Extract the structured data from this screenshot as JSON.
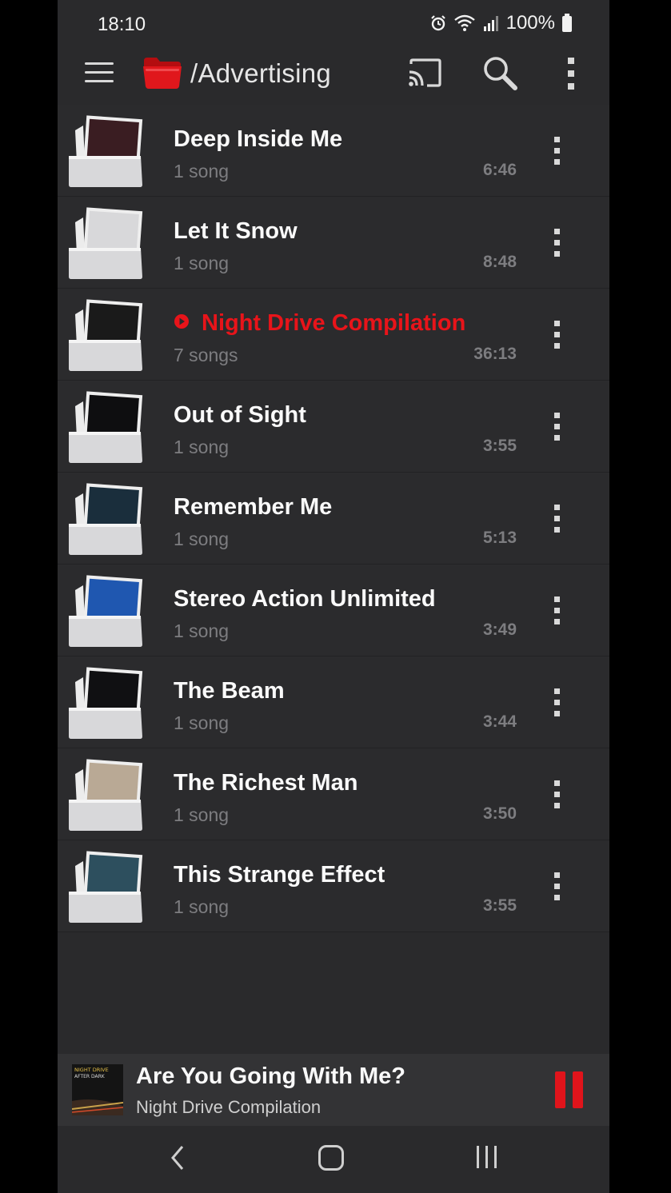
{
  "status": {
    "time": "18:10",
    "battery_text": "100%",
    "icons": [
      "alarm-icon",
      "wifi-icon",
      "signal-icon",
      "battery-icon"
    ]
  },
  "toolbar": {
    "title": "/Advertising",
    "icons": [
      "menu-icon",
      "folder-icon",
      "cast-icon",
      "search-icon",
      "more-vert-icon"
    ]
  },
  "colors": {
    "background": "#2a2a2c",
    "accent": "#e8141a",
    "secondary_text": "#7d7d80"
  },
  "list": [
    {
      "title": "Deep Inside Me",
      "subtitle": "1 song",
      "duration": "6:46",
      "playing": false,
      "art": "#3a1d22"
    },
    {
      "title": "Let It Snow",
      "subtitle": "1 song",
      "duration": "8:48",
      "playing": false,
      "art": "#d8d8da"
    },
    {
      "title": "Night Drive Compilation",
      "subtitle": "7 songs",
      "duration": "36:13",
      "playing": true,
      "art": "#1a1a1a"
    },
    {
      "title": "Out of Sight",
      "subtitle": "1 song",
      "duration": "3:55",
      "playing": false,
      "art": "#0e0e10"
    },
    {
      "title": "Remember Me",
      "subtitle": "1 song",
      "duration": "5:13",
      "playing": false,
      "art": "#1a2e3c"
    },
    {
      "title": "Stereo Action Unlimited",
      "subtitle": "1 song",
      "duration": "3:49",
      "playing": false,
      "art": "#1f57b0"
    },
    {
      "title": "The Beam",
      "subtitle": "1 song",
      "duration": "3:44",
      "playing": false,
      "art": "#101012"
    },
    {
      "title": "The Richest Man",
      "subtitle": "1 song",
      "duration": "3:50",
      "playing": false,
      "art": "#b9a995"
    },
    {
      "title": "This Strange Effect",
      "subtitle": "1 song",
      "duration": "3:55",
      "playing": false,
      "art": "#2d4f5e"
    }
  ],
  "now_playing": {
    "title": "Are You Going With Me?",
    "subtitle": "Night Drive Compilation",
    "art_text_line1": "NIGHT DRIVE",
    "art_text_line2": "AFTER DARK"
  },
  "navbar": {
    "icons": [
      "back-icon",
      "home-icon",
      "recents-icon"
    ]
  }
}
